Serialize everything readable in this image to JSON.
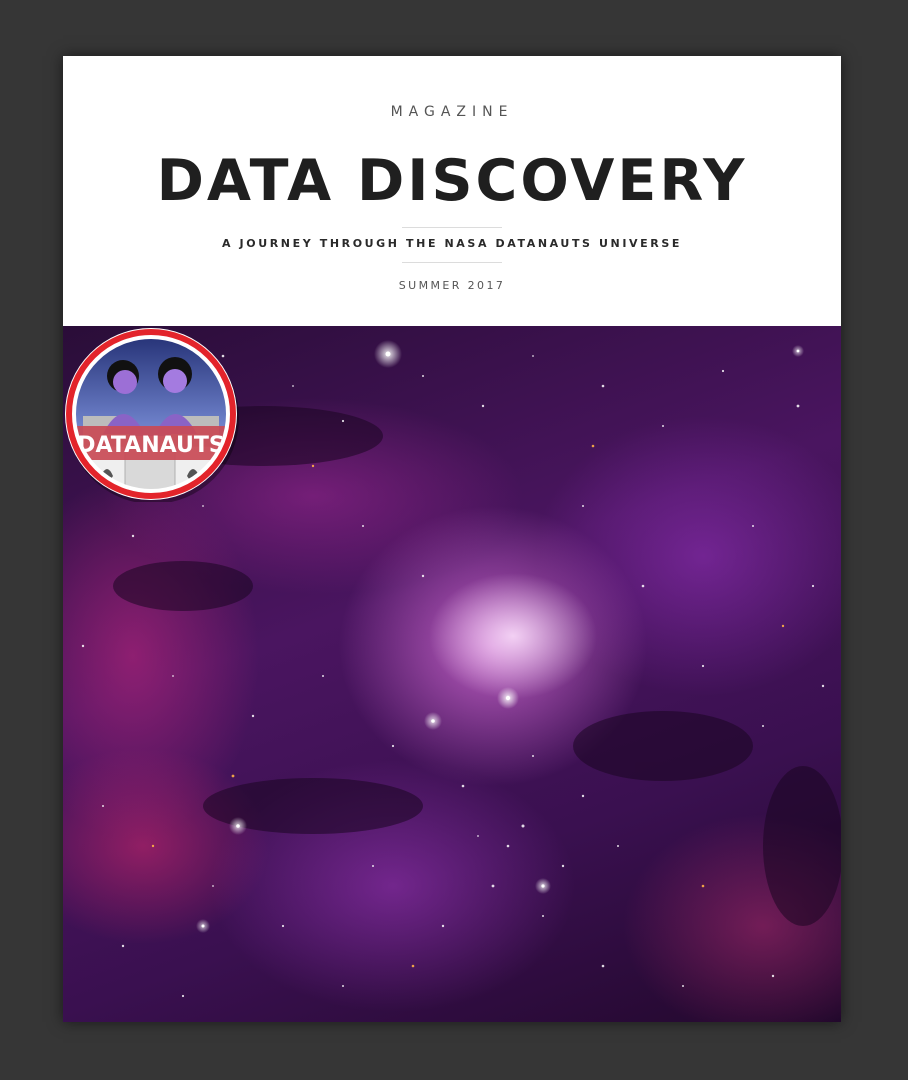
{
  "cover": {
    "kicker": "MAGAZINE",
    "title": "DATA DISCOVERY",
    "subtitle": "A JOURNEY THROUGH THE NASA DATANAUTS UNIVERSE",
    "issue": "SUMMER 2017"
  },
  "badge": {
    "label": "DATANAUTS",
    "ring_color": "#e3242b"
  }
}
